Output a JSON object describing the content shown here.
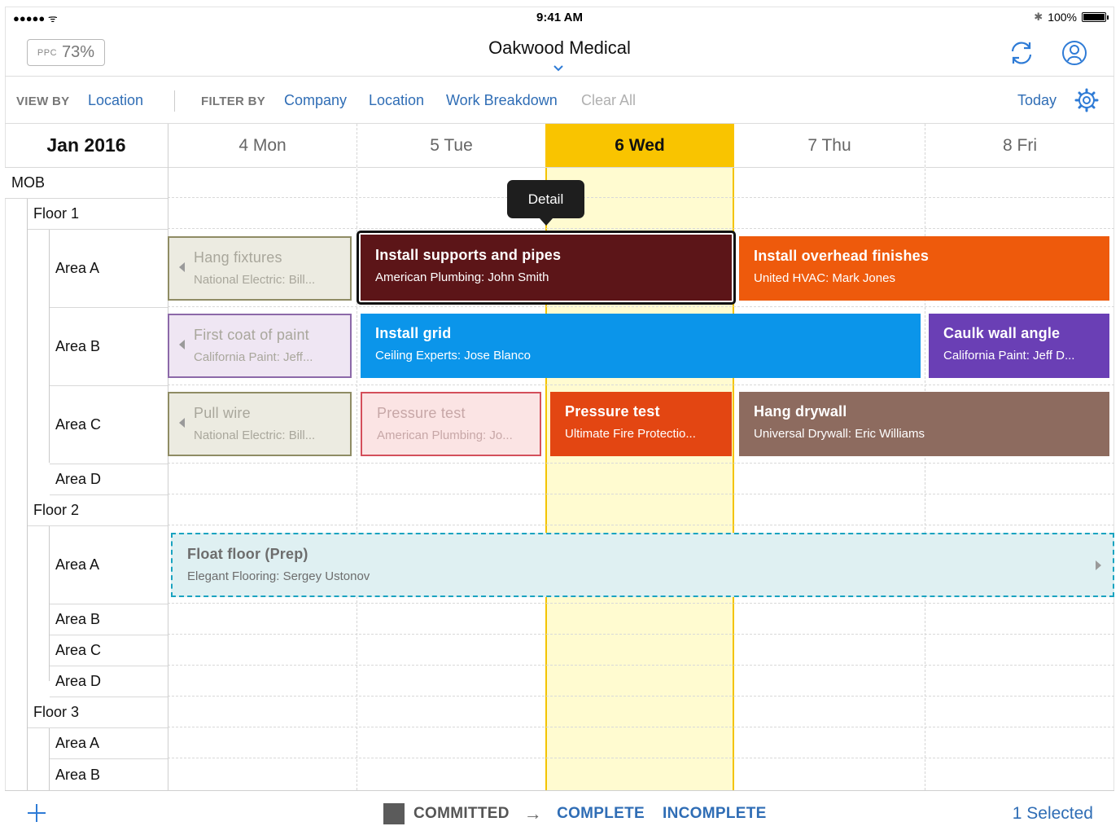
{
  "status_bar": {
    "signal": "●●●●● ᯤ",
    "time": "9:41 AM",
    "bluetooth": "✱",
    "battery": "100%"
  },
  "header": {
    "ppc_label": "PPC",
    "ppc_value": "73%",
    "title": "Oakwood Medical",
    "title_chevron": "⌄"
  },
  "toolbar": {
    "view_by_label": "VIEW BY",
    "view_by_value": "Location",
    "filter_by_label": "FILTER BY",
    "filters": [
      "Company",
      "Location",
      "Work Breakdown"
    ],
    "clear_all": "Clear All",
    "today": "Today"
  },
  "calendar": {
    "month": "Jan 2016",
    "days": [
      "4 Mon",
      "5 Tue",
      "6 Wed",
      "7 Thu",
      "8 Fri"
    ],
    "today_index": 2
  },
  "locations": {
    "site": "MOB",
    "floor1": "Floor 1",
    "floor2": "Floor 2",
    "floor3": "Floor 3",
    "areas": [
      "Area A",
      "Area B",
      "Area C",
      "Area D"
    ]
  },
  "tooltip": "Detail",
  "tasks": [
    {
      "title": "Hang fixtures",
      "subtitle": "National Electric: Bill...",
      "style": "past"
    },
    {
      "title": "Install supports and pipes",
      "subtitle": "American Plumbing: John Smith",
      "style": "selected"
    },
    {
      "title": "Install overhead finishes",
      "subtitle": "United HVAC: Mark Jones",
      "style": "orange"
    },
    {
      "title": "First coat of paint",
      "subtitle": "California Paint: Jeff...",
      "style": "past"
    },
    {
      "title": "Install grid",
      "subtitle": "Ceiling Experts: Jose Blanco",
      "style": "blue"
    },
    {
      "title": "Caulk wall angle",
      "subtitle": "California Paint: Jeff D...",
      "style": "violet"
    },
    {
      "title": "Pull wire",
      "subtitle": "National Electric: Bill...",
      "style": "past"
    },
    {
      "title": "Pressure test",
      "subtitle": "American Plumbing: Jo...",
      "style": "incomplete"
    },
    {
      "title": "Pressure test",
      "subtitle": "Ultimate Fire Protectio...",
      "style": "red"
    },
    {
      "title": "Hang drywall",
      "subtitle": "Universal Drywall: Eric Williams",
      "style": "brown"
    },
    {
      "title": "Float floor (Prep)",
      "subtitle": "Elegant Flooring: Sergey Ustonov",
      "style": "dashed"
    }
  ],
  "footer": {
    "legend_committed": "COMMITTED",
    "legend_arrow": "→",
    "legend_complete": "COMPLETE",
    "legend_incomplete": "INCOMPLETE",
    "selected": "1 Selected"
  },
  "colors": {
    "accent": "#2f6db5",
    "today": "#f9c400",
    "selected_task": "#5c1518",
    "orange_task": "#ee5a0c",
    "blue_task": "#0b95ea",
    "violet_task": "#6a3fb5",
    "red_task": "#e34612",
    "brown_task": "#8d6b5f"
  }
}
